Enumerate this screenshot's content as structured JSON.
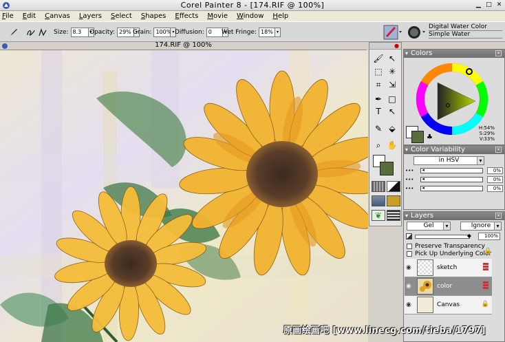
{
  "window": {
    "title": "Corel Painter 8 - [174.RIF @ 100%]"
  },
  "menu": [
    "File",
    "Edit",
    "Canvas",
    "Layers",
    "Select",
    "Shapes",
    "Effects",
    "Movie",
    "Window",
    "Help"
  ],
  "properties": {
    "size_label": "Size:",
    "size_value": "8.3",
    "opacity_label": "Opacity:",
    "opacity_value": "29%",
    "grain_label": "Grain:",
    "grain_value": "100%",
    "diffusion_label": "Diffusion:",
    "diffusion_value": "0",
    "wet_fringe_label": "Wet Fringe:",
    "wet_fringe_value": "18%"
  },
  "brush": {
    "category": "Digital Water Color",
    "variant": "Simple Water"
  },
  "document": {
    "title": "174.RIF @ 100%"
  },
  "colors_panel": {
    "title": "Colors",
    "h": "H:54%",
    "s": "S:29%",
    "v": "V:33%",
    "main_color": "#5a6b3c"
  },
  "color_variability": {
    "title": "Color Variability",
    "mode": "in HSV",
    "rows": [
      "0%",
      "0%",
      "0%"
    ]
  },
  "layers_panel": {
    "title": "Layers",
    "composite_method": "Gel",
    "composite_depth": "Ignore",
    "opacity": "100%",
    "preserve_transparency": "Preserve Transparency",
    "pick_up_underlying": "Pick Up Underlying Color",
    "layers": [
      {
        "name": "sketch",
        "selected": false
      },
      {
        "name": "color",
        "selected": true
      },
      {
        "name": "Canvas",
        "selected": false
      }
    ]
  },
  "watermark": "原画绘画吧 [www.linecg.com/tieba/1797]"
}
